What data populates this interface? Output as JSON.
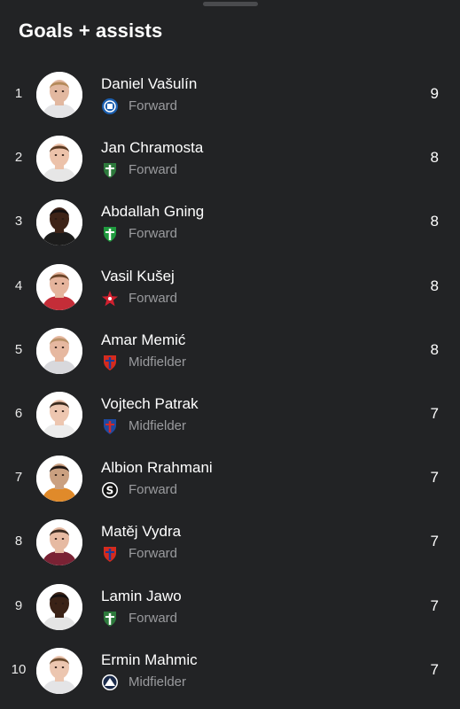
{
  "title": "Goals + assists",
  "colors": {
    "background": "#222325",
    "text_primary": "#ffffff",
    "text_secondary": "#9a9b9e"
  },
  "players": [
    {
      "rank": "1",
      "name": "Daniel Vašulín",
      "position": "Forward",
      "value": "9",
      "club_icon": "club-crest-blue-circle-icon",
      "skin": "#e2b8a0",
      "hair": "#b48a5a",
      "shirt": "#e4e4e6",
      "club": {
        "shape": "circle",
        "fill": "#1b5fb0",
        "accent": "#ffffff"
      }
    },
    {
      "rank": "2",
      "name": "Jan Chramosta",
      "position": "Forward",
      "value": "8",
      "club_icon": "club-crest-green-shield-icon",
      "skin": "#ecc2aa",
      "hair": "#5a3a22",
      "shirt": "#e6e6e6",
      "club": {
        "shape": "shield",
        "fill": "#2d7a3c",
        "accent": "#ffffff"
      }
    },
    {
      "rank": "3",
      "name": "Abdallah Gning",
      "position": "Forward",
      "value": "8",
      "club_icon": "club-crest-green-white-icon",
      "skin": "#3e2418",
      "hair": "#141010",
      "shirt": "#1c1c1c",
      "club": {
        "shape": "shield",
        "fill": "#1f9a3e",
        "accent": "#ffffff"
      }
    },
    {
      "rank": "4",
      "name": "Vasil Kušej",
      "position": "Forward",
      "value": "8",
      "club_icon": "club-crest-red-star-icon",
      "skin": "#e5b49c",
      "hair": "#6a4428",
      "shirt": "#c42d38",
      "club": {
        "shape": "star",
        "fill": "#d2202f",
        "accent": "#ffffff"
      }
    },
    {
      "rank": "5",
      "name": "Amar Memić",
      "position": "Midfielder",
      "value": "8",
      "club_icon": "club-crest-red-blue-shield-icon",
      "skin": "#e6b8a0",
      "hair": "#b89068",
      "shirt": "#d8d8dc",
      "club": {
        "shape": "shield",
        "fill": "#d52b1e",
        "accent": "#1e3c96"
      }
    },
    {
      "rank": "6",
      "name": "Vojtech Patrak",
      "position": "Midfielder",
      "value": "7",
      "club_icon": "club-crest-blue-red-shield-icon",
      "skin": "#edc6b0",
      "hair": "#3a2a1e",
      "shirt": "#ececec",
      "club": {
        "shape": "shield",
        "fill": "#1e4aa0",
        "accent": "#d22a2a"
      }
    },
    {
      "rank": "7",
      "name": "Albion Rrahmani",
      "position": "Forward",
      "value": "7",
      "club_icon": "club-crest-black-s-icon",
      "skin": "#caa080",
      "hair": "#201612",
      "shirt": "#e08a2a",
      "club": {
        "shape": "circle-s",
        "fill": "#111111",
        "accent": "#ffffff"
      }
    },
    {
      "rank": "8",
      "name": "Matěj Vydra",
      "position": "Forward",
      "value": "7",
      "club_icon": "club-crest-red-blue-shield-icon",
      "skin": "#e6baa2",
      "hair": "#3a2a20",
      "shirt": "#7a2234",
      "club": {
        "shape": "shield",
        "fill": "#d52b1e",
        "accent": "#1e3c96"
      }
    },
    {
      "rank": "9",
      "name": "Lamin Jawo",
      "position": "Forward",
      "value": "7",
      "club_icon": "club-crest-green-shield-icon",
      "skin": "#3a2216",
      "hair": "#141010",
      "shirt": "#e4e4e4",
      "club": {
        "shape": "shield",
        "fill": "#2d7a3c",
        "accent": "#ffffff"
      }
    },
    {
      "rank": "10",
      "name": "Ermin Mahmic",
      "position": "Midfielder",
      "value": "7",
      "club_icon": "club-crest-navy-circle-icon",
      "skin": "#ecc6b0",
      "hair": "#6a4a2e",
      "shirt": "#e4e4e6",
      "club": {
        "shape": "circle-m",
        "fill": "#1a2a4a",
        "accent": "#ffffff"
      }
    }
  ]
}
